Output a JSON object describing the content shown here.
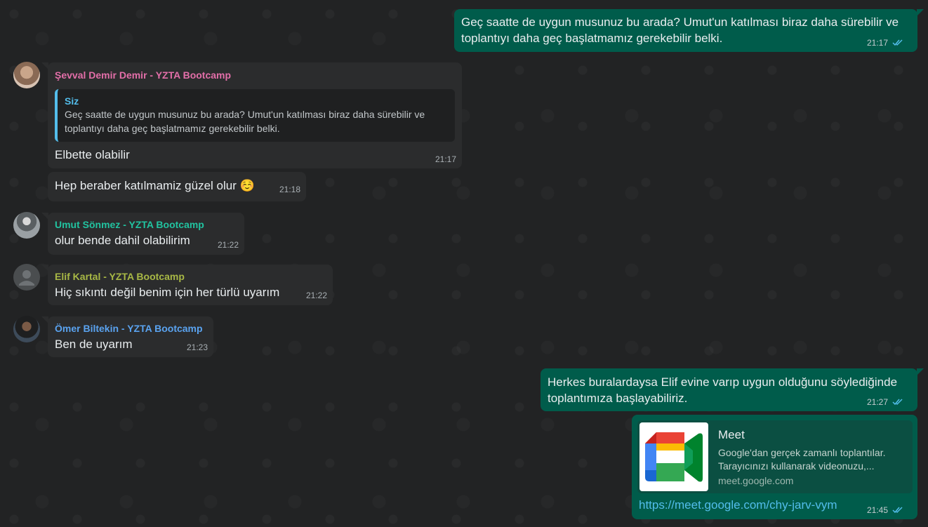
{
  "messages": {
    "m1": {
      "text": "Geç saatte de uygun musunuz bu arada? Umut'un katılması biraz daha sürebilir ve toplantıyı daha geç başlatmamız gerekebilir belki.",
      "time": "21:17"
    },
    "m2": {
      "sender": "Şevval Demir Demir - YZTA Bootcamp",
      "sender_color": "#e36fa9",
      "quote_name": "Siz",
      "quote_text": "Geç saatte de uygun musunuz bu arada? Umut'un katılması biraz daha sürebilir ve toplantıyı daha geç başlatmamız gerekebilir belki.",
      "text": "Elbette olabilir",
      "time": "21:17"
    },
    "m3": {
      "text": "Hep beraber katılmamiz güzel olur ☺️",
      "time": "21:18"
    },
    "m4": {
      "sender": "Umut Sönmez - YZTA Bootcamp",
      "sender_color": "#21c3a0",
      "text": "olur bende dahil olabilirim",
      "time": "21:22"
    },
    "m5": {
      "sender": "Elif Kartal - YZTA Bootcamp",
      "sender_color": "#a8b845",
      "text": "Hiç sıkıntı değil benim için her türlü uyarım",
      "time": "21:22"
    },
    "m6": {
      "sender": "Ömer Biltekin - YZTA Bootcamp",
      "sender_color": "#5aa3f0",
      "text": "Ben de uyarım",
      "time": "21:23"
    },
    "m7": {
      "text": "Herkes buralardaysa Elif evine varıp uygun olduğunu söylediğinde toplantımıza başlayabiliriz.",
      "time": "21:27"
    },
    "m8": {
      "link_title": "Meet",
      "link_desc": "Google'dan gerçek zamanlı toplantılar. Tarayıcınızı kullanarak videonuzu,...",
      "link_domain": "meet.google.com",
      "url": "https://meet.google.com/chy-jarv-vym",
      "time": "21:45"
    }
  },
  "icons": {
    "read_receipt": "double-check-icon",
    "default_avatar": "person-icon",
    "meet_logo": "google-meet-logo-icon"
  },
  "colors": {
    "outgoing": "#005c4b",
    "incoming": "#2b2c2d",
    "read_tick": "#53bdeb"
  }
}
